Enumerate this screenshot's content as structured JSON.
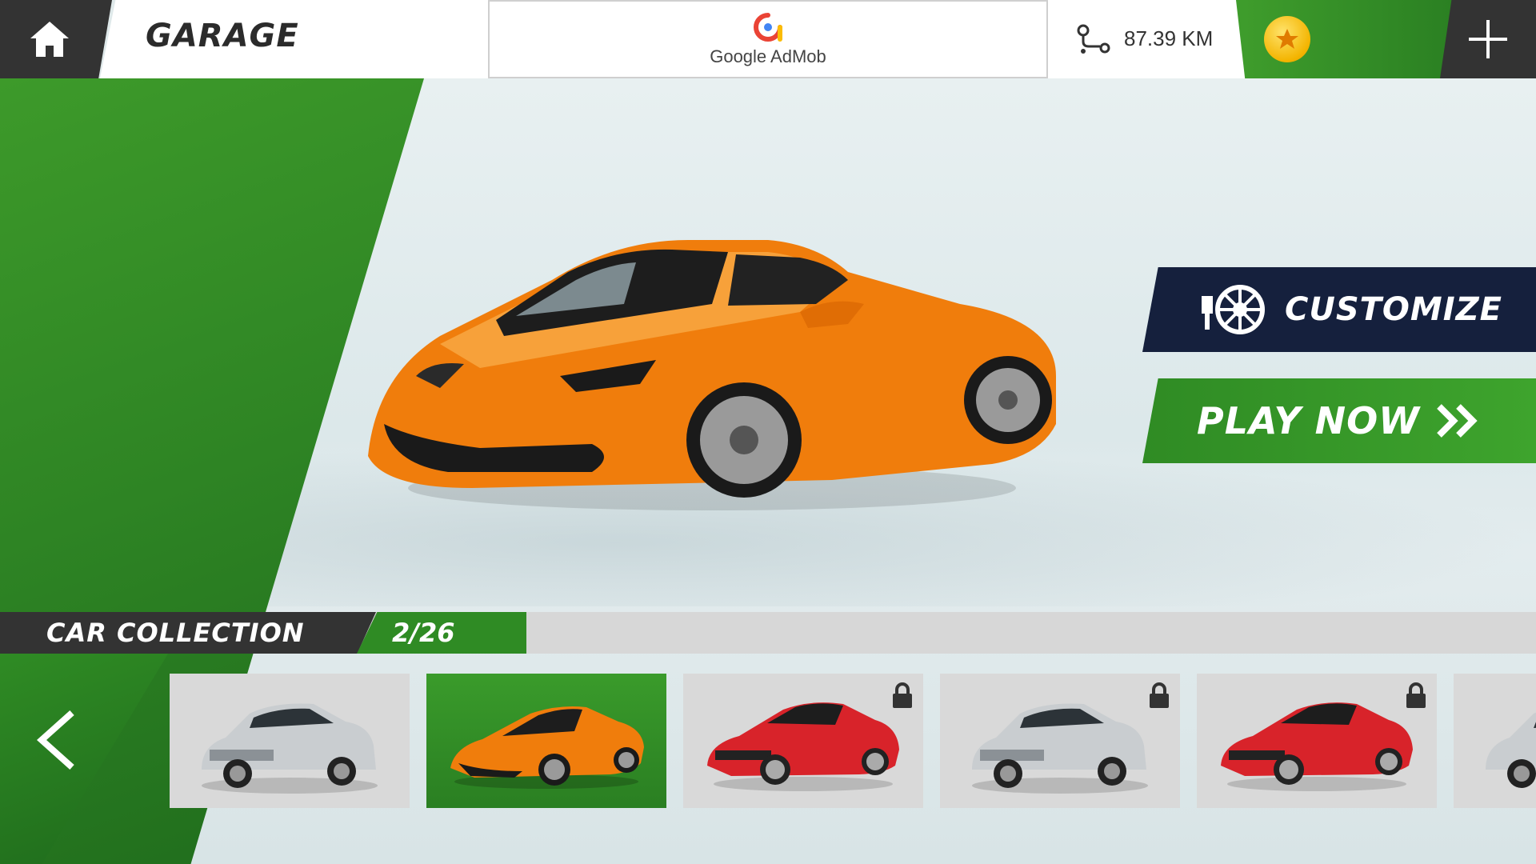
{
  "header": {
    "title": "GARAGE",
    "ad_label": "Google AdMob",
    "distance": "87.39 KM"
  },
  "buttons": {
    "customize": "CUSTOMIZE",
    "play": "PLAY NOW"
  },
  "collection": {
    "title": "CAR COLLECTION",
    "count": "2/26",
    "cars": [
      {
        "model": "silver-sedan",
        "locked": false,
        "selected": false
      },
      {
        "model": "orange-supercar",
        "locked": false,
        "selected": true
      },
      {
        "model": "red-sportscar",
        "locked": true,
        "selected": false
      },
      {
        "model": "silver-sedan",
        "locked": true,
        "selected": false
      },
      {
        "model": "red-sportscar",
        "locked": true,
        "selected": false
      },
      {
        "model": "silver-sedan",
        "locked": false,
        "selected": false
      }
    ]
  },
  "colors": {
    "green": "#2f8b24",
    "dark": "#333333",
    "navy": "#15203d",
    "car_orange": "#f07d0c"
  },
  "icons": [
    "home-icon",
    "route-icon",
    "coin-icon",
    "plus-icon",
    "wheel-brush-icon",
    "double-chevron-right-icon",
    "chevron-left-icon",
    "lock-icon"
  ]
}
